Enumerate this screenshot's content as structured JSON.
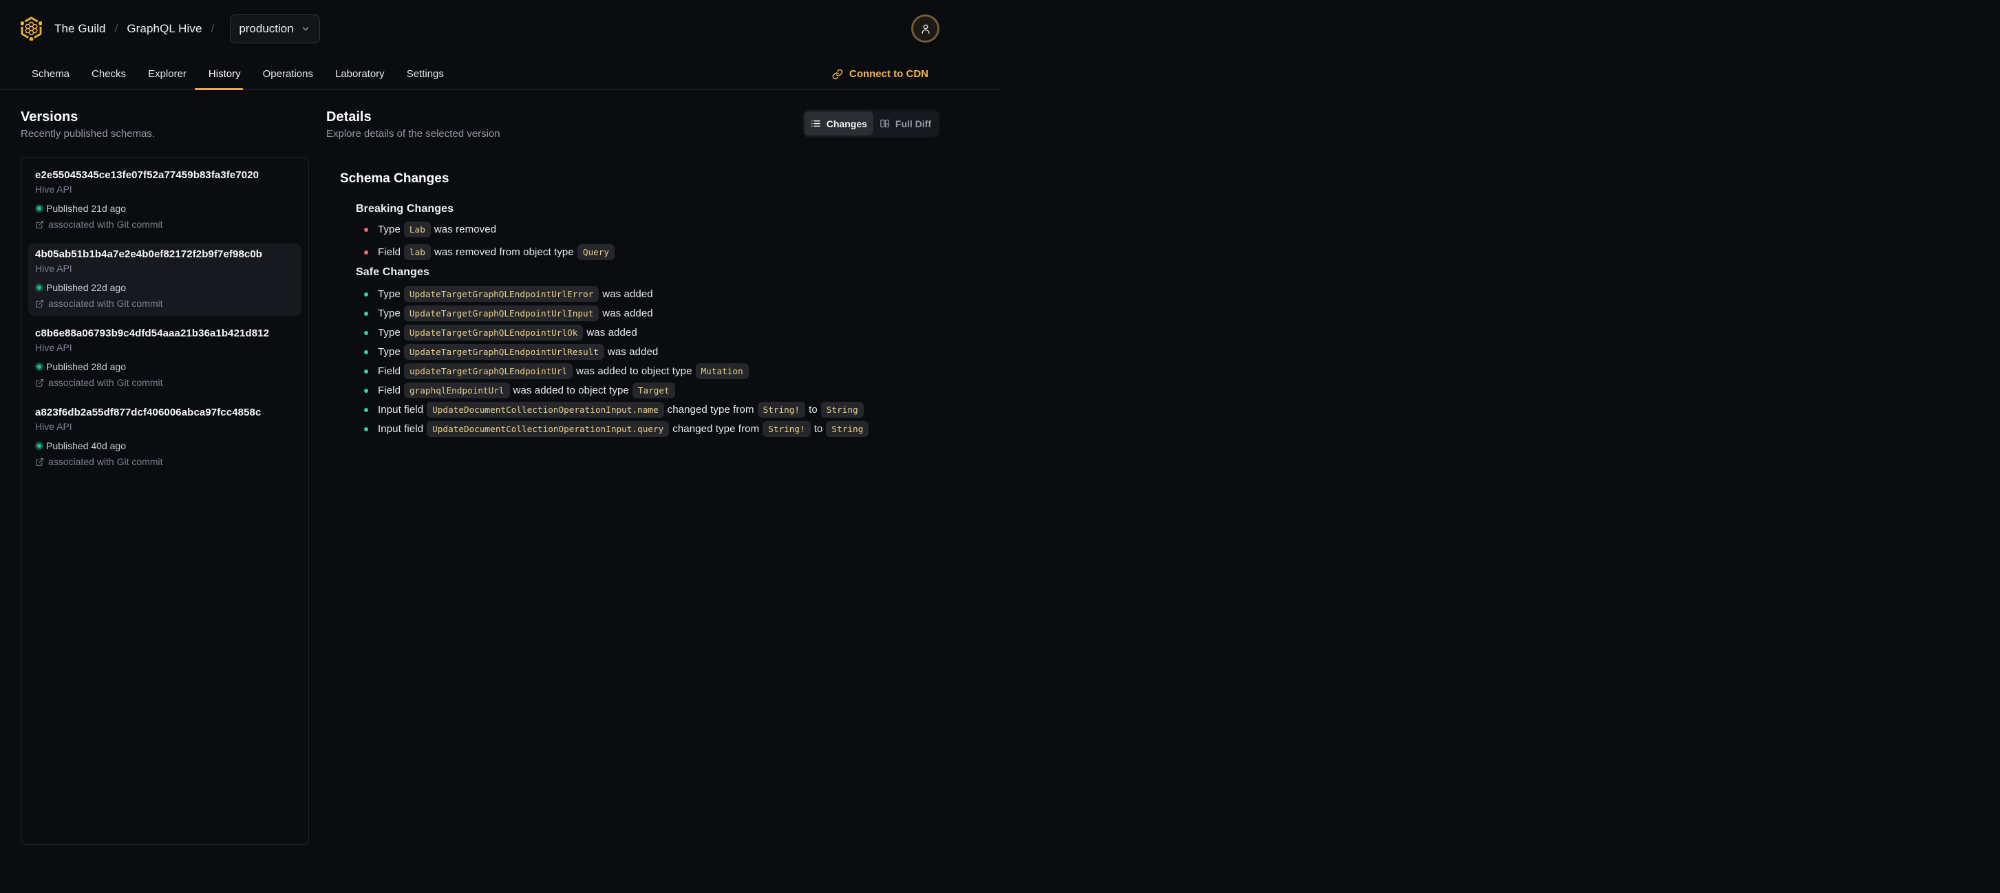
{
  "header": {
    "org": "The Guild",
    "project": "GraphQL Hive",
    "separator": "/",
    "target_selector": {
      "value": "production"
    }
  },
  "tabs": [
    {
      "label": "Schema",
      "active": false
    },
    {
      "label": "Checks",
      "active": false
    },
    {
      "label": "Explorer",
      "active": false
    },
    {
      "label": "History",
      "active": true
    },
    {
      "label": "Operations",
      "active": false
    },
    {
      "label": "Laboratory",
      "active": false
    },
    {
      "label": "Settings",
      "active": false
    }
  ],
  "connect_cdn_label": "Connect to CDN",
  "versions": {
    "title": "Versions",
    "subtitle": "Recently published schemas.",
    "items": [
      {
        "hash": "e2e55045345ce13fe07f52a77459b83fa3fe7020",
        "service": "Hive API",
        "published": "Published 21d ago",
        "git": "associated with Git commit",
        "selected": false
      },
      {
        "hash": "4b05ab51b1b4a7e2e4b0ef82172f2b9f7ef98c0b",
        "service": "Hive API",
        "published": "Published 22d ago",
        "git": "associated with Git commit",
        "selected": true
      },
      {
        "hash": "c8b6e88a06793b9c4dfd54aaa21b36a1b421d812",
        "service": "Hive API",
        "published": "Published 28d ago",
        "git": "associated with Git commit",
        "selected": false
      },
      {
        "hash": "a823f6db2a55df877dcf406006abca97fcc4858c",
        "service": "Hive API",
        "published": "Published 40d ago",
        "git": "associated with Git commit",
        "selected": false
      }
    ]
  },
  "details": {
    "title": "Details",
    "subtitle": "Explore details of the selected version",
    "toggle": {
      "changes": "Changes",
      "full_diff": "Full Diff"
    },
    "section_title": "Schema Changes",
    "breaking": {
      "title": "Breaking Changes",
      "items": [
        {
          "segments": [
            {
              "text": "Type"
            },
            {
              "code": "Lab"
            },
            {
              "text": "was removed"
            }
          ]
        },
        {
          "segments": [
            {
              "text": "Field"
            },
            {
              "code": "lab"
            },
            {
              "text": "was removed from object type"
            },
            {
              "code": "Query"
            }
          ]
        }
      ]
    },
    "safe": {
      "title": "Safe Changes",
      "items": [
        {
          "segments": [
            {
              "text": "Type"
            },
            {
              "code": "UpdateTargetGraphQLEndpointUrlError"
            },
            {
              "text": "was added"
            }
          ]
        },
        {
          "segments": [
            {
              "text": "Type"
            },
            {
              "code": "UpdateTargetGraphQLEndpointUrlInput"
            },
            {
              "text": "was added"
            }
          ]
        },
        {
          "segments": [
            {
              "text": "Type"
            },
            {
              "code": "UpdateTargetGraphQLEndpointUrlOk"
            },
            {
              "text": "was added"
            }
          ]
        },
        {
          "segments": [
            {
              "text": "Type"
            },
            {
              "code": "UpdateTargetGraphQLEndpointUrlResult"
            },
            {
              "text": "was added"
            }
          ]
        },
        {
          "segments": [
            {
              "text": "Field"
            },
            {
              "code": "updateTargetGraphQLEndpointUrl"
            },
            {
              "text": "was added to object type"
            },
            {
              "code": "Mutation"
            }
          ]
        },
        {
          "segments": [
            {
              "text": "Field"
            },
            {
              "code": "graphqlEndpointUrl"
            },
            {
              "text": "was added to object type"
            },
            {
              "code": "Target"
            }
          ]
        },
        {
          "segments": [
            {
              "text": "Input field"
            },
            {
              "code": "UpdateDocumentCollectionOperationInput.name"
            },
            {
              "text": "changed type from"
            },
            {
              "code": "String!"
            },
            {
              "text": "to"
            },
            {
              "code": "String"
            }
          ]
        },
        {
          "segments": [
            {
              "text": "Input field"
            },
            {
              "code": "UpdateDocumentCollectionOperationInput.query"
            },
            {
              "text": "changed type from"
            },
            {
              "code": "String!"
            },
            {
              "text": "to"
            },
            {
              "code": "String"
            }
          ]
        }
      ]
    }
  },
  "colors": {
    "background": "#0a0c10",
    "accent": "#f4a93c",
    "logo_gold": "#f0b236",
    "code_text": "#e9cf87",
    "published_green": "#16b177",
    "breaking_red": "#e96c6c",
    "safe_green": "#33d39b"
  }
}
